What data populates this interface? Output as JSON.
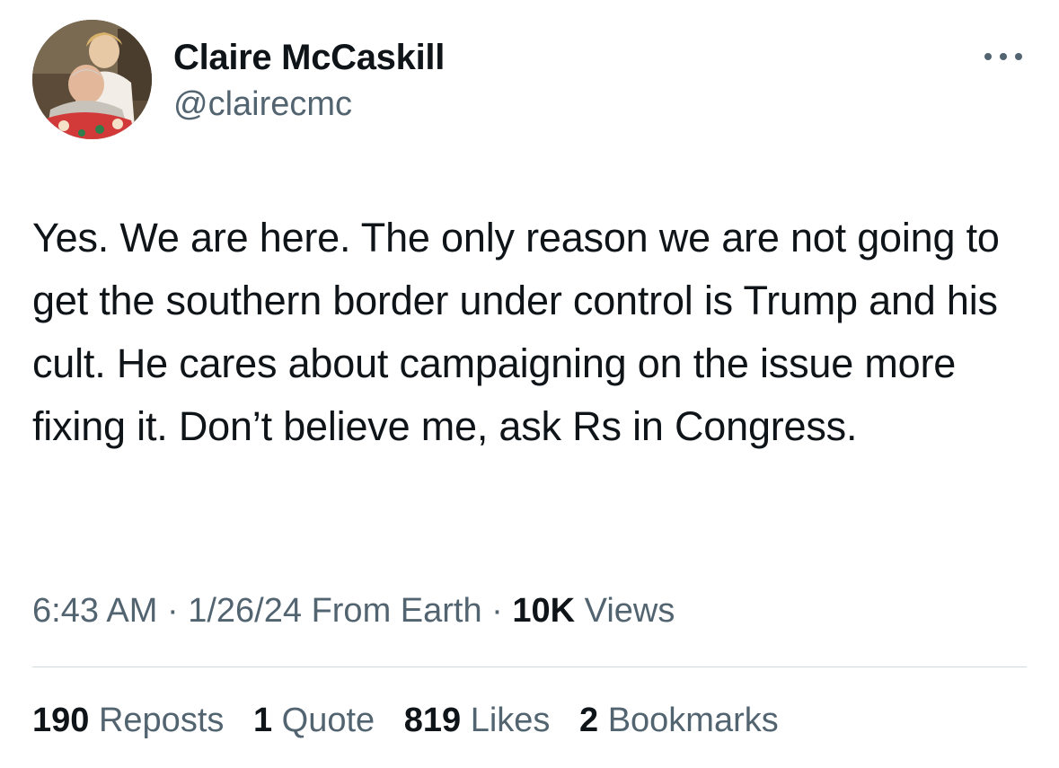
{
  "author": {
    "display_name": "Claire McCaskill",
    "handle": "@clairecmc",
    "avatar_icon": "profile-photo"
  },
  "more_icon": "more-horizontal-icon",
  "tweet": {
    "text": "Yes. We are here. The only reason we are not going to get the southern border under control is Trump and his cult. He cares about campaigning on the issue more fixing it. Don’t believe me, ask Rs in Congress."
  },
  "meta": {
    "time": "6:43 AM",
    "separator": "·",
    "date": "1/26/24",
    "source": "From Earth",
    "views_count": "10K",
    "views_label": "Views"
  },
  "stats": {
    "reposts_count": "190",
    "reposts_label": "Reposts",
    "quotes_count": "1",
    "quotes_label": "Quote",
    "likes_count": "819",
    "likes_label": "Likes",
    "bookmarks_count": "2",
    "bookmarks_label": "Bookmarks"
  },
  "colors": {
    "text_primary": "#0f1419",
    "text_secondary": "#536471",
    "divider": "#cfd9de"
  }
}
